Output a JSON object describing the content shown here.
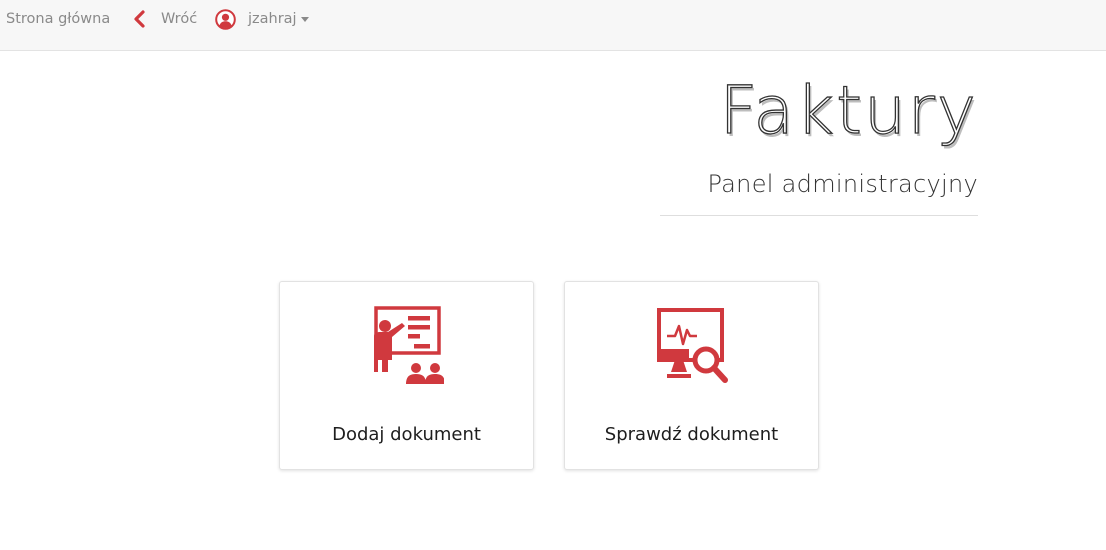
{
  "nav": {
    "home_label": "Strona główna",
    "back_label": "Wróć",
    "user_label": "jzahraj"
  },
  "header": {
    "title": "Faktury",
    "subtitle": "Panel administracyjny"
  },
  "cards": [
    {
      "label": "Dodaj dokument",
      "icon": "presentation-teacher-icon"
    },
    {
      "label": "Sprawdź dokument",
      "icon": "monitor-search-icon"
    }
  ],
  "colors": {
    "accent": "#d0393e",
    "navbar_bg": "#f7f7f7",
    "nav_text": "#8a8a8a"
  }
}
